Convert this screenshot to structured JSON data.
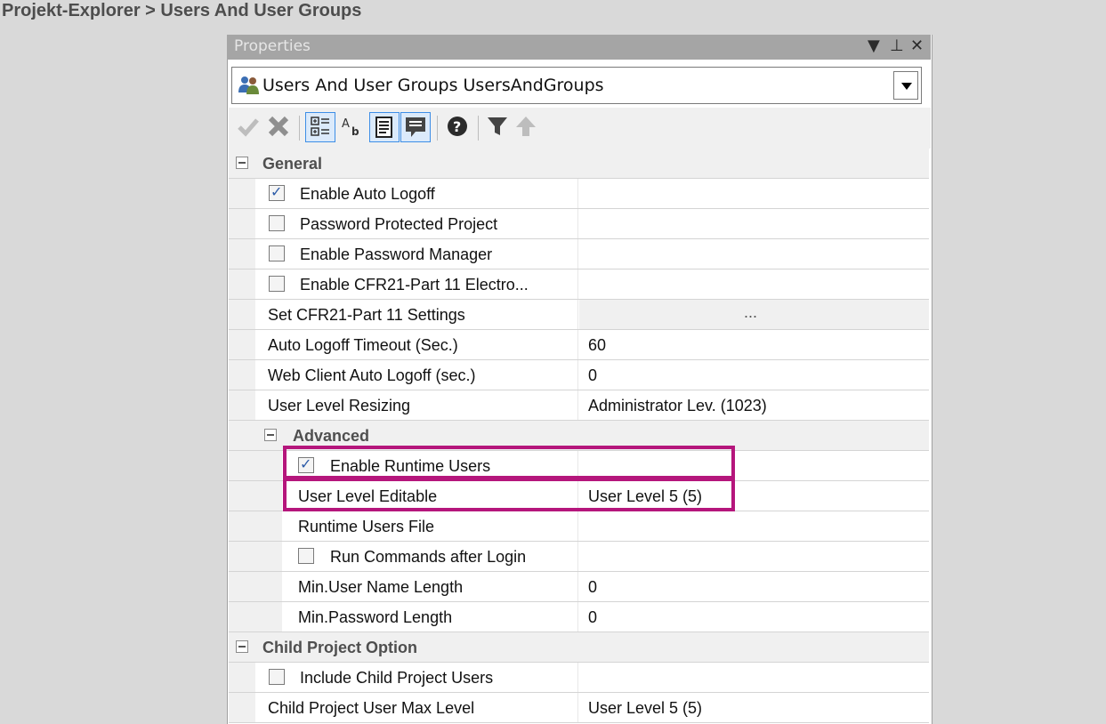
{
  "breadcrumb": "Projekt-Explorer > Users And User Groups",
  "panel": {
    "title": "Properties",
    "object_selector": "Users And User Groups UsersAndGroups"
  },
  "icons": {
    "check": "check-icon",
    "delete": "x-icon",
    "categorized": "categorized-icon",
    "alphabetical": "alphabetical-icon",
    "property_pages": "property-pages-icon",
    "description": "description-icon",
    "help": "help-icon",
    "filter": "filter-icon",
    "up": "up-arrow-icon"
  },
  "colors": {
    "highlight": "#b5167c",
    "checkbox_mark": "#2c5ba8"
  },
  "categories": {
    "general": "General",
    "advanced": "Advanced",
    "child": "Child Project Option"
  },
  "general": [
    {
      "label": "Enable Auto Logoff",
      "checkbox": true,
      "checked": true,
      "value": ""
    },
    {
      "label": "Password Protected Project",
      "checkbox": true,
      "checked": false,
      "value": ""
    },
    {
      "label": "Enable Password Manager",
      "checkbox": true,
      "checked": false,
      "value": ""
    },
    {
      "label": "Enable CFR21-Part 11 Electro...",
      "checkbox": true,
      "checked": false,
      "value": ""
    },
    {
      "label": "Set CFR21-Part 11 Settings",
      "checkbox": false,
      "value": "..."
    },
    {
      "label": "Auto Logoff Timeout (Sec.)",
      "checkbox": false,
      "value": "60"
    },
    {
      "label": "Web Client Auto Logoff (sec.)",
      "checkbox": false,
      "value": "0"
    },
    {
      "label": "User Level Resizing",
      "checkbox": false,
      "value": "Administrator Lev. (1023)"
    }
  ],
  "advanced": [
    {
      "label": "Enable Runtime Users",
      "checkbox": true,
      "checked": true,
      "value": ""
    },
    {
      "label": "User Level Editable",
      "checkbox": false,
      "value": "User Level 5 (5)"
    },
    {
      "label": "Runtime Users File",
      "checkbox": false,
      "value": ""
    },
    {
      "label": "Run Commands after Login",
      "checkbox": true,
      "checked": false,
      "value": ""
    },
    {
      "label": "Min.User Name Length",
      "checkbox": false,
      "value": "0"
    },
    {
      "label": "Min.Password Length",
      "checkbox": false,
      "value": "0"
    }
  ],
  "child": [
    {
      "label": "Include Child Project Users",
      "checkbox": true,
      "checked": false,
      "value": ""
    },
    {
      "label": "Child Project User Max Level",
      "checkbox": false,
      "value": "User Level 5 (5)"
    }
  ]
}
